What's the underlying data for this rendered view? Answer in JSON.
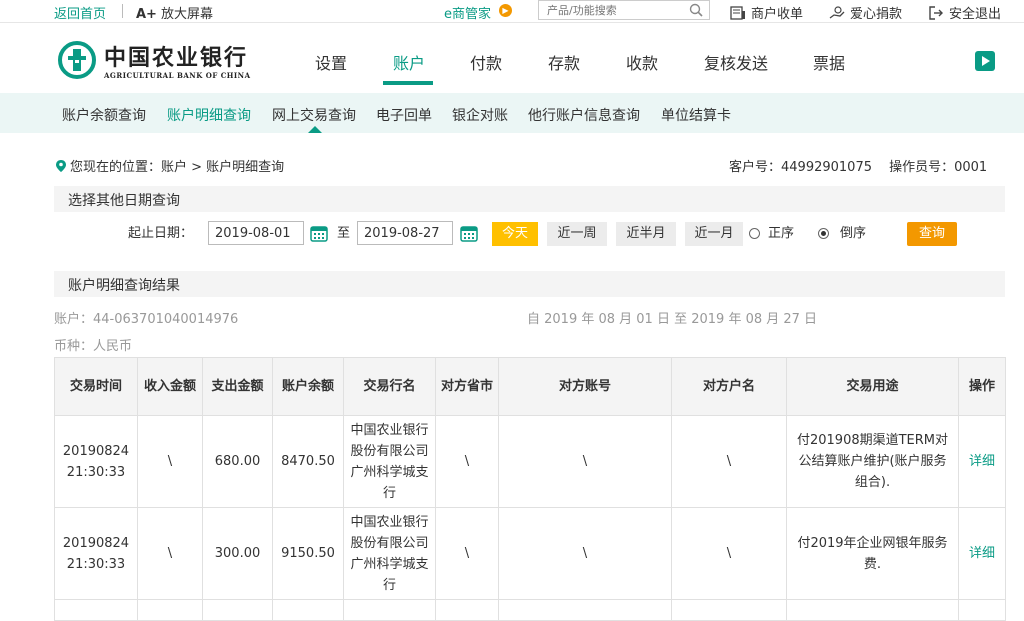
{
  "topbar": {
    "home": "返回首页",
    "zoom_prefix": "A+",
    "zoom_label": "放大屏幕",
    "emanager": "e商管家",
    "search_placeholder": "产品/功能搜索",
    "links": [
      "商户收单",
      "爱心捐款",
      "安全退出"
    ]
  },
  "logo": {
    "cn": "中国农业银行",
    "en": "AGRICULTURAL BANK OF CHINA"
  },
  "mainnav": [
    "设置",
    "账户",
    "付款",
    "存款",
    "收款",
    "复核发送",
    "票据"
  ],
  "mainnav_active": "账户",
  "subnav": [
    "账户余额查询",
    "账户明细查询",
    "网上交易查询",
    "电子回单",
    "银企对账",
    "他行账户信息查询",
    "单位结算卡"
  ],
  "subnav_active": "账户明细查询",
  "breadcrumb": "您现在的位置：账户 > 账户明细查询",
  "customer": "客户号：44992901075　 操作员号：0001",
  "query": {
    "heading": "选择其他日期查询",
    "start_label": "起止日期：",
    "start_date": "2019-08-01",
    "to_label": "至",
    "end_date": "2019-08-27",
    "btn_today": "今天",
    "btn_week": "近一周",
    "btn_halfmonth": "近半月",
    "btn_month": "近一月",
    "order_asc": "正序",
    "order_desc": "倒序",
    "order_selected": "倒序",
    "btn_query": "查询"
  },
  "results": {
    "heading": "账户明细查询结果",
    "account": "账户：44-063701040014976",
    "period": "自 2019 年 08 月 01 日 至 2019 年 08 月 27 日",
    "currency": "币种：人民币",
    "columns": [
      "交易时间",
      "收入金额",
      "支出金额",
      "账户余额",
      "交易行名",
      "对方省市",
      "对方账号",
      "对方户名",
      "交易用途",
      "操作"
    ],
    "rows": [
      {
        "time": "20190824 21:30:33",
        "income": "\\",
        "expense": "680.00",
        "balance": "8470.50",
        "bank": "中国农业银行股份有限公司广州科学城支行",
        "province": "\\",
        "acct": "\\",
        "name": "\\",
        "purpose": "付201908期渠道TERM对公结算账户维护(账户服务组合).",
        "op": "详细"
      },
      {
        "time": "20190824 21:30:33",
        "income": "\\",
        "expense": "300.00",
        "balance": "9150.50",
        "bank": "中国农业银行股份有限公司广州科学城支行",
        "province": "\\",
        "acct": "\\",
        "name": "\\",
        "purpose": "付2019年企业网银年服务费.",
        "op": "详细"
      }
    ]
  },
  "colors": {
    "accent": "#0a9b85",
    "orange": "#f39800",
    "yellow": "#ffc000"
  }
}
